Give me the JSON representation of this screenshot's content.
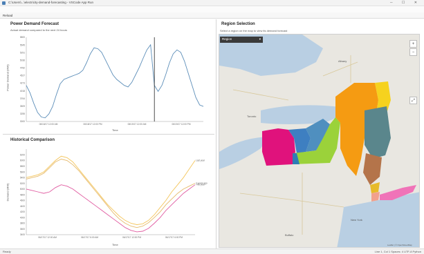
{
  "window": {
    "title": "C:\\Users\\...\\electricity-demand-forecasting - VSCode App Run",
    "menu": [
      "File",
      "Edit",
      "View",
      "Run",
      "Window",
      "Help"
    ],
    "toolbar_label": "Reload"
  },
  "forecast": {
    "title": "Power Demand Forecast",
    "subtitle": "Actual demand compared to the next 24 hours",
    "x_ticks": [
      "06/18/17 12:00 AM",
      "06/18/17 12:00 PM",
      "06/19/17 12:00 AM",
      "06/19/17 12:00 PM"
    ],
    "xlabel": "Time",
    "ylabel": "Power Demand (MW)"
  },
  "history": {
    "title": "Historical Comparison",
    "x_ticks": [
      "06/17/17 12:00 AM",
      "06/17/17 6:00 AM",
      "06/17/17 12:00 PM",
      "06/17/17 6:00 PM"
    ],
    "xlabel": "Time",
    "ylabel": "Demand (MW)",
    "series_labels": [
      "Last year",
      "2 years ago",
      "This year"
    ]
  },
  "region": {
    "title": "Region Selection",
    "subtitle": "Select a region on the map to view its demand forecast",
    "dropdown_value": "Region",
    "zoom_in": "+",
    "zoom_out": "−",
    "map_labels": [
      "Toronto",
      "Albany",
      "New York",
      "Buffalo"
    ],
    "attribution": "Leaflet | © OpenStreetMap"
  },
  "status": {
    "left": "Ready",
    "right": "Line 1, Col 1   Spaces: 4   UTF-8   Python"
  },
  "chart_data": [
    {
      "type": "line",
      "title": "Power Demand Forecast",
      "xlabel": "Time",
      "ylabel": "Power Demand (MW)",
      "x": [
        0,
        1,
        2,
        3,
        4,
        5,
        6,
        7,
        8,
        9,
        10,
        11,
        12,
        13,
        14,
        15,
        16,
        17,
        18,
        19,
        20,
        21,
        22,
        23,
        24,
        25,
        26,
        27,
        28,
        29,
        30,
        31,
        32,
        33,
        34,
        35,
        36,
        37,
        38,
        39,
        40,
        41,
        42,
        43,
        44,
        45,
        46,
        47
      ],
      "series": [
        {
          "values": [
            4200,
            3950,
            3600,
            3300,
            3150,
            3120,
            3250,
            3500,
            3900,
            4250,
            4400,
            4450,
            4500,
            4550,
            4600,
            4700,
            4950,
            5250,
            5450,
            5420,
            5300,
            5050,
            4800,
            4550,
            4400,
            4300,
            4200,
            4150,
            4300,
            4550,
            4800,
            5100,
            5380,
            5550,
            4200,
            4000,
            4200,
            4550,
            4950,
            5250,
            5380,
            5300,
            5000,
            4600,
            4200,
            3800,
            3550,
            3500
          ]
        }
      ],
      "ylim": [
        3000,
        5800
      ]
    },
    {
      "type": "line",
      "title": "Historical Comparison",
      "xlabel": "Time",
      "ylabel": "Demand (MW)",
      "x": [
        0,
        1,
        2,
        3,
        4,
        5,
        6,
        7,
        8,
        9,
        10,
        11,
        12,
        13,
        14,
        15,
        16,
        17,
        18,
        19,
        20,
        21,
        22,
        23,
        24,
        25,
        26,
        27,
        28,
        29
      ],
      "series": [
        {
          "name": "Last year",
          "values": [
            5400,
            5450,
            5500,
            5600,
            5800,
            6000,
            6150,
            6100,
            5950,
            5700,
            5450,
            5200,
            4950,
            4700,
            4450,
            4250,
            4050,
            3900,
            3800,
            3750,
            3780,
            3900,
            4100,
            4350,
            4600,
            4900,
            5150,
            5400,
            5700,
            6000
          ]
        },
        {
          "name": "2 years ago",
          "values": [
            5350,
            5400,
            5450,
            5550,
            5750,
            5950,
            6050,
            6000,
            5850,
            5650,
            5400,
            5150,
            4900,
            4650,
            4400,
            4150,
            3950,
            3800,
            3700,
            3650,
            3700,
            3820,
            4000,
            4200,
            4450,
            4650,
            4850,
            5000,
            5100,
            5200
          ]
        },
        {
          "name": "This year",
          "values": [
            5000,
            4950,
            4900,
            4850,
            4900,
            5050,
            5150,
            5100,
            5000,
            4850,
            4700,
            4550,
            4400,
            4250,
            4100,
            3950,
            3800,
            3650,
            3550,
            3500,
            3520,
            3620,
            3800,
            4000,
            4250,
            4450,
            4650,
            4850,
            5000,
            5150
          ]
        }
      ],
      "ylim": [
        3400,
        6400
      ],
      "y_ticks": [
        3400,
        3600,
        3800,
        4000,
        4200,
        4400,
        4600,
        4800,
        5000,
        5200,
        5400,
        5600,
        5800,
        6000,
        6200
      ]
    }
  ],
  "colors": {
    "forecast_line": "#5b8db8",
    "forecast_marker": "#222222",
    "last_year": "#f4c55a",
    "two_years": "#e6b96a",
    "this_year": "#e05aa0",
    "map_water": "#b9cfe3",
    "map_land": "#ecebe4"
  }
}
